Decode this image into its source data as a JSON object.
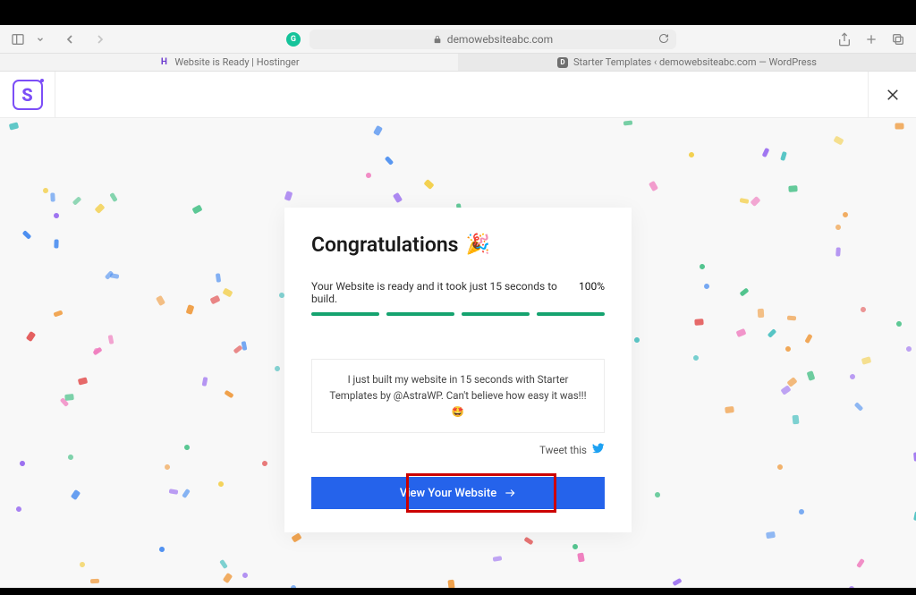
{
  "browser": {
    "url_domain": "demowebsiteabc.com",
    "tabs": [
      {
        "label": "Website is Ready | Hostinger",
        "active": true
      },
      {
        "label": "Starter Templates ‹ demowebsiteabc.com — WordPress",
        "active": false
      }
    ]
  },
  "app_header": {
    "logo_letter": "S"
  },
  "card": {
    "heading": "Congratulations",
    "status_text": "Your Website is ready and it took just 15 seconds to build.",
    "percent": "100%",
    "tweet_text": "I just built my website in 15 seconds with Starter Templates by @AstraWP. Can't believe how easy it was!!! 🤩",
    "tweet_label": "Tweet this",
    "cta_label": "View Your Website"
  },
  "confetti_colors": {
    "red": "#e35a5a",
    "orange": "#f0a14b",
    "yellow": "#f3d04f",
    "green": "#4cc28a",
    "teal": "#4bc1c1",
    "blue": "#4b8ef0",
    "purple": "#9b6ff0",
    "pink": "#ef7fbf"
  }
}
